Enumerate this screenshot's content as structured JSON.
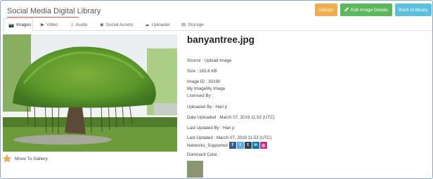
{
  "header": {
    "title": "Social Media Digital Library",
    "design_label": "Design",
    "edit_label": "Edit Image Details",
    "back_label": "Back to library"
  },
  "tabs": [
    {
      "label": "Images",
      "icon": "camera-icon",
      "active": true
    },
    {
      "label": "Video",
      "icon": "video-icon"
    },
    {
      "label": "Audio",
      "icon": "music-icon"
    },
    {
      "label": "Social Assets",
      "icon": "globe-icon"
    },
    {
      "label": "Uploader",
      "icon": "cloud-upload-icon"
    },
    {
      "label": "Storage",
      "icon": "storage-icon"
    }
  ],
  "gallery": {
    "move_label": "Move To Gallery",
    "star_color": "#f0ad4e"
  },
  "details": {
    "filename": "banyantree.jpg",
    "source": "Source : Upload Image",
    "size": "Size : 163.8 KB",
    "image_id": "Image ID : 30190",
    "my_image": "My ImageMy Image",
    "licensed_by": "Licensed By :",
    "uploaded_by": "Uploaded By : Hari p",
    "date_uploaded": "Date Uploaded : March 07, 2019 11:52 (UTC)",
    "last_updated_by": "Last Updated By : Hari p",
    "last_updated": "Last Updated : March 07, 2019 11:53 (UTC)",
    "networks_label": "Networks_Supported",
    "networks": [
      {
        "name": "facebook-icon",
        "glyph": "f",
        "color": "#3b5998"
      },
      {
        "name": "twitter-icon",
        "glyph": "t",
        "color": "#55acee"
      },
      {
        "name": "tumblr-icon",
        "glyph": "t",
        "color": "#35465c"
      },
      {
        "name": "linkedin-icon",
        "glyph": "in",
        "color": "#0077b5"
      },
      {
        "name": "instagram-icon",
        "glyph": "◎",
        "color": "#c13584"
      }
    ],
    "dominant_color_label": "Dominant Color :",
    "dominant_color": "#8a9470"
  },
  "colors": {
    "accent_underline": "#d9534f",
    "design_button": "#f0ad4e",
    "edit_button": "#5cb85c",
    "back_button": "#5bc0de"
  }
}
